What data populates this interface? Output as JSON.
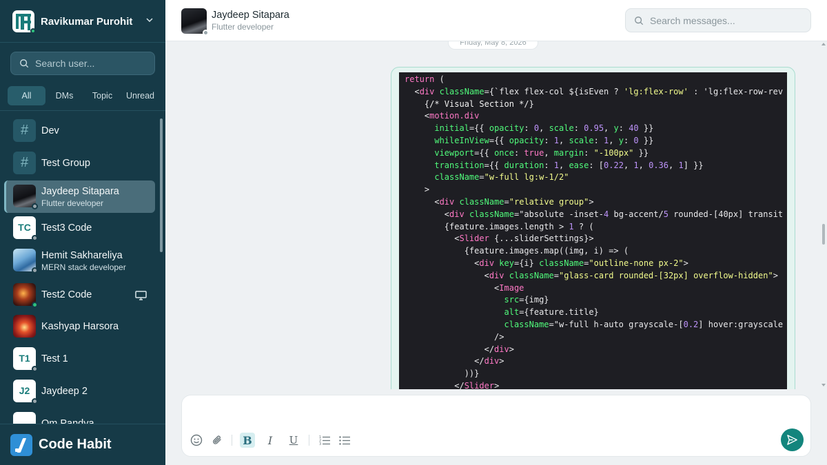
{
  "workspace": {
    "name": "Ravikumar Purohit"
  },
  "sidebar": {
    "search_placeholder": "Search user...",
    "filters": [
      {
        "label": "All",
        "active": true
      },
      {
        "label": "DMs",
        "active": false
      },
      {
        "label": "Topic",
        "active": false
      },
      {
        "label": "Unread",
        "active": false
      }
    ],
    "items": [
      {
        "name": "Dev",
        "avatar": "#",
        "kind": "channel"
      },
      {
        "name": "Test Group",
        "avatar": "#",
        "kind": "channel"
      },
      {
        "name": "Jaydeep Sitapara",
        "subtitle": "Flutter developer",
        "avatar_image": "car-photo",
        "status": "offline",
        "active": true
      },
      {
        "name": "Test3 Code",
        "avatar": "TC",
        "status": "offline"
      },
      {
        "name": "Hemit Sakhareliya",
        "subtitle": "MERN stack developer",
        "avatar_image": "app-illustration",
        "status": "offline"
      },
      {
        "name": "Test2 Code",
        "avatar_image": "fireworks-photo",
        "status": "online",
        "trailing_icon": "monitor-icon"
      },
      {
        "name": "Kashyap Harsora",
        "avatar_image": "fireworks-photo-2"
      },
      {
        "name": "Test 1",
        "avatar": "T1",
        "status": "offline"
      },
      {
        "name": "Jaydeep 2",
        "avatar": "J2",
        "status": "offline"
      },
      {
        "name": "Om Pandya",
        "avatar": ""
      }
    ]
  },
  "brand": {
    "name": "Code Habit",
    "color": "#2f8fd6"
  },
  "chat": {
    "title": "Jaydeep Sitapara",
    "subtitle": "Flutter developer",
    "search_placeholder": "Search messages...",
    "date_divider": "Friday, May 8, 2026",
    "code_lines": [
      "return (",
      "  <div className={`flex flex-col ${isEven ? 'lg:flex-row' : 'lg:flex-row-rev",
      "    {/* Visual Section */}",
      "    <motion.div",
      "      initial={{ opacity: 0, scale: 0.95, y: 40 }}",
      "      whileInView={{ opacity: 1, scale: 1, y: 0 }}",
      "      viewport={{ once: true, margin: \"-100px\" }}",
      "      transition={{ duration: 1, ease: [0.22, 1, 0.36, 1] }}",
      "      className=\"w-full lg:w-1/2\"",
      "    >",
      "      <div className=\"relative group\">",
      "        <div className=\"absolute -inset-4 bg-accent/5 rounded-[40px] transit",
      "        {feature.images.length > 1 ? (",
      "          <Slider {...sliderSettings}>",
      "            {feature.images.map((img, i) => (",
      "              <div key={i} className=\"outline-none px-2\">",
      "                <div className=\"glass-card rounded-[32px] overflow-hidden\">",
      "                  <Image",
      "                    src={img}",
      "                    alt={feature.title}",
      "                    className=\"w-full h-auto grayscale-[0.2] hover:grayscale",
      "                  />",
      "                </div>",
      "              </div>",
      "            ))}",
      "          </Slider>"
    ]
  },
  "composer": {
    "placeholder": "",
    "tools": [
      "emoji-icon",
      "paperclip-icon",
      "B",
      "I",
      "U",
      "ordered-list-icon",
      "bullet-list-icon"
    ],
    "accent": "#13857d"
  },
  "colors": {
    "sidebar_bg": "#163a47",
    "accent": "#1a7c7a"
  }
}
